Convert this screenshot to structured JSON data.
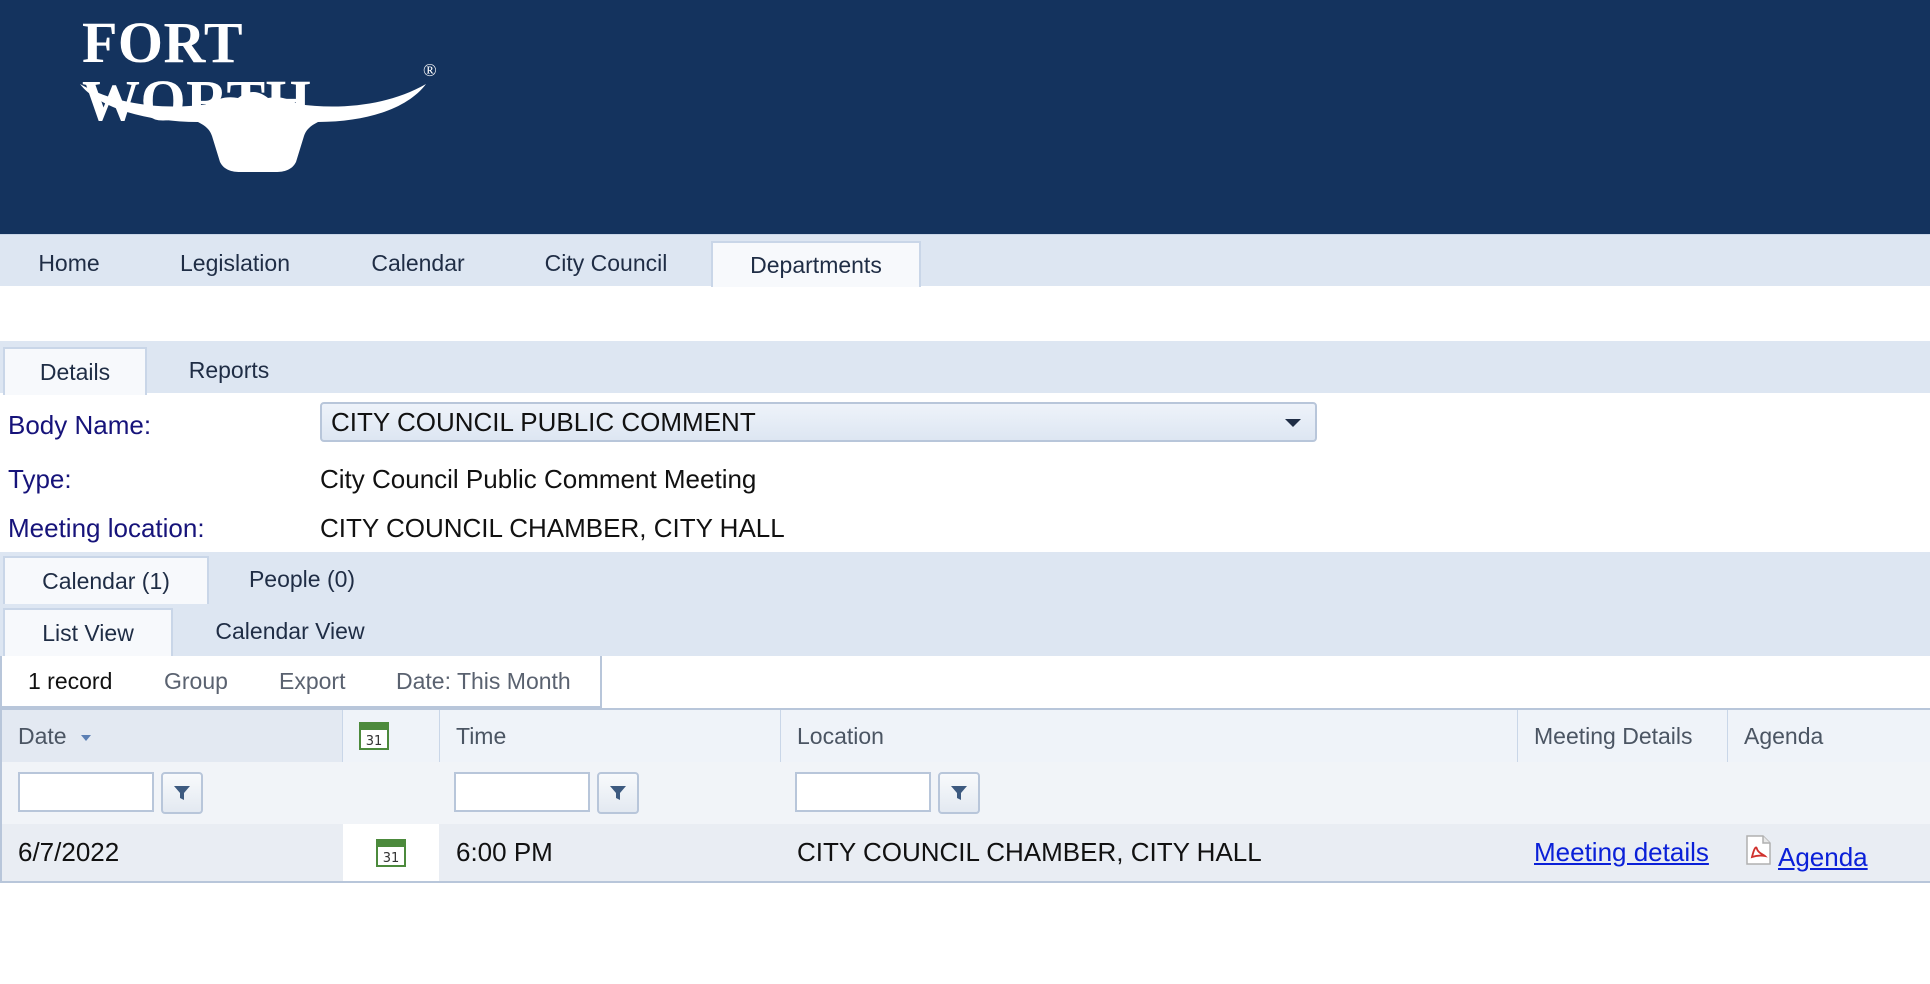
{
  "brand": {
    "logo_text": "FORT WORTH",
    "registered": "®"
  },
  "main_nav": {
    "tabs": [
      {
        "label": "Home"
      },
      {
        "label": "Legislation"
      },
      {
        "label": "Calendar"
      },
      {
        "label": "City Council"
      },
      {
        "label": "Departments",
        "active": true
      }
    ]
  },
  "sub_tabs": [
    {
      "label": "Details",
      "active": true
    },
    {
      "label": "Reports"
    }
  ],
  "details": {
    "body_name_label": "Body Name:",
    "body_name_value": "CITY COUNCIL PUBLIC COMMENT",
    "type_label": "Type:",
    "type_value": "City Council Public Comment Meeting",
    "location_label": "Meeting location:",
    "location_value": "CITY COUNCIL CHAMBER, CITY HALL"
  },
  "section_tabs": [
    {
      "label": "Calendar (1)",
      "active": true
    },
    {
      "label": "People (0)"
    }
  ],
  "view_tabs": [
    {
      "label": "List View",
      "active": true
    },
    {
      "label": "Calendar View"
    }
  ],
  "toolbar": {
    "record_count": "1 record",
    "group": "Group",
    "export": "Export",
    "date_filter": "Date: This Month"
  },
  "grid": {
    "columns": [
      "Date",
      "Time",
      "Location",
      "Meeting Details",
      "Agenda"
    ],
    "calendar_icon_text": "31",
    "rows": [
      {
        "date": "6/7/2022",
        "time": "6:00 PM",
        "location": "CITY COUNCIL CHAMBER, CITY HALL",
        "meeting_details": "Meeting details",
        "agenda": "Agenda"
      }
    ]
  },
  "colors": {
    "header_bg": "#14335e",
    "tab_band": "#dde6f2",
    "label": "#16137a",
    "link": "#0a20d8"
  }
}
